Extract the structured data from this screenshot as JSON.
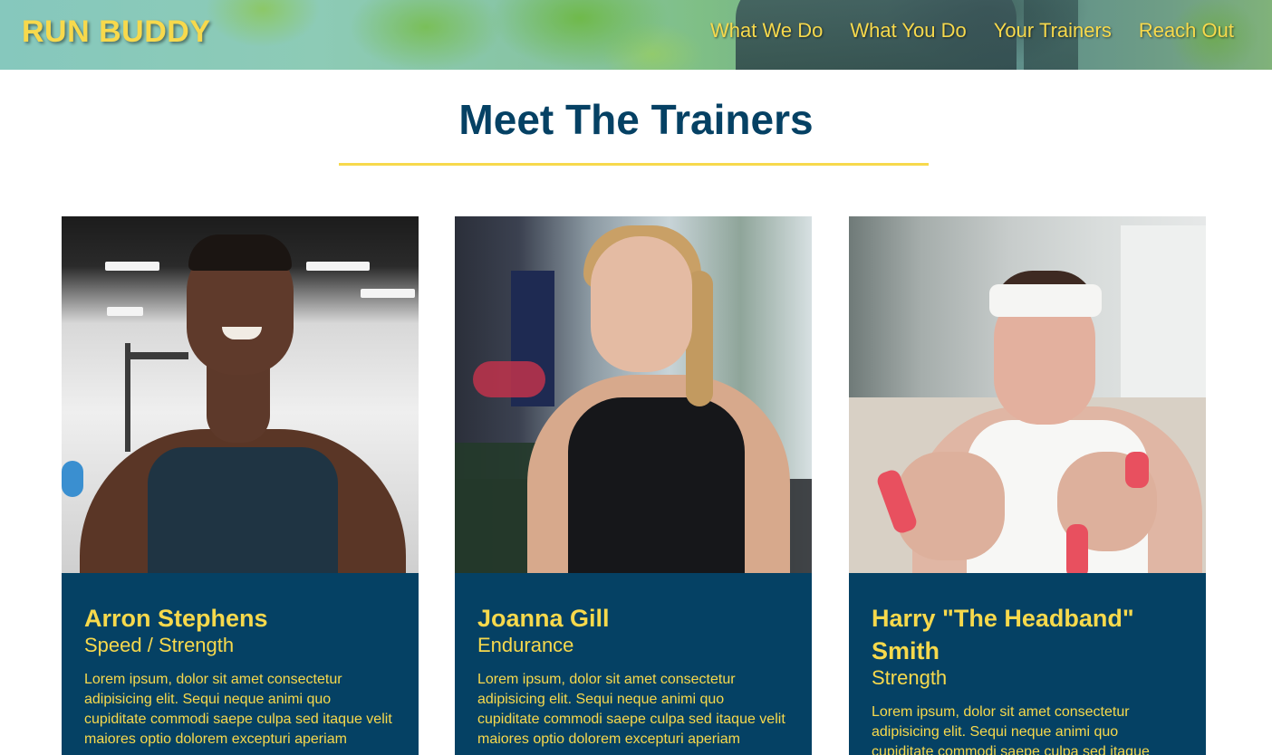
{
  "header": {
    "brand": "RUN BUDDY",
    "nav": [
      "What We Do",
      "What You Do",
      "Your Trainers",
      "Reach Out"
    ]
  },
  "section": {
    "title": "Meet The Trainers"
  },
  "trainers": [
    {
      "name": "Arron Stephens",
      "role": "Speed / Strength",
      "bio": "Lorem ipsum, dolor sit amet consectetur adipisicing elit. Sequi neque animi quo cupiditate commodi saepe culpa sed itaque velit maiores optio dolorem excepturi aperiam"
    },
    {
      "name": "Joanna Gill",
      "role": "Endurance",
      "bio": "Lorem ipsum, dolor sit amet consectetur adipisicing elit. Sequi neque animi quo cupiditate commodi saepe culpa sed itaque velit maiores optio dolorem excepturi aperiam"
    },
    {
      "name": "Harry \"The Headband\" Smith",
      "role": "Strength",
      "bio": "Lorem ipsum, dolor sit amet consectetur adipisicing elit. Sequi neque animi quo cupiditate commodi saepe culpa sed itaque"
    }
  ],
  "colors": {
    "primary": "#054164",
    "accent": "#f7d94c"
  }
}
